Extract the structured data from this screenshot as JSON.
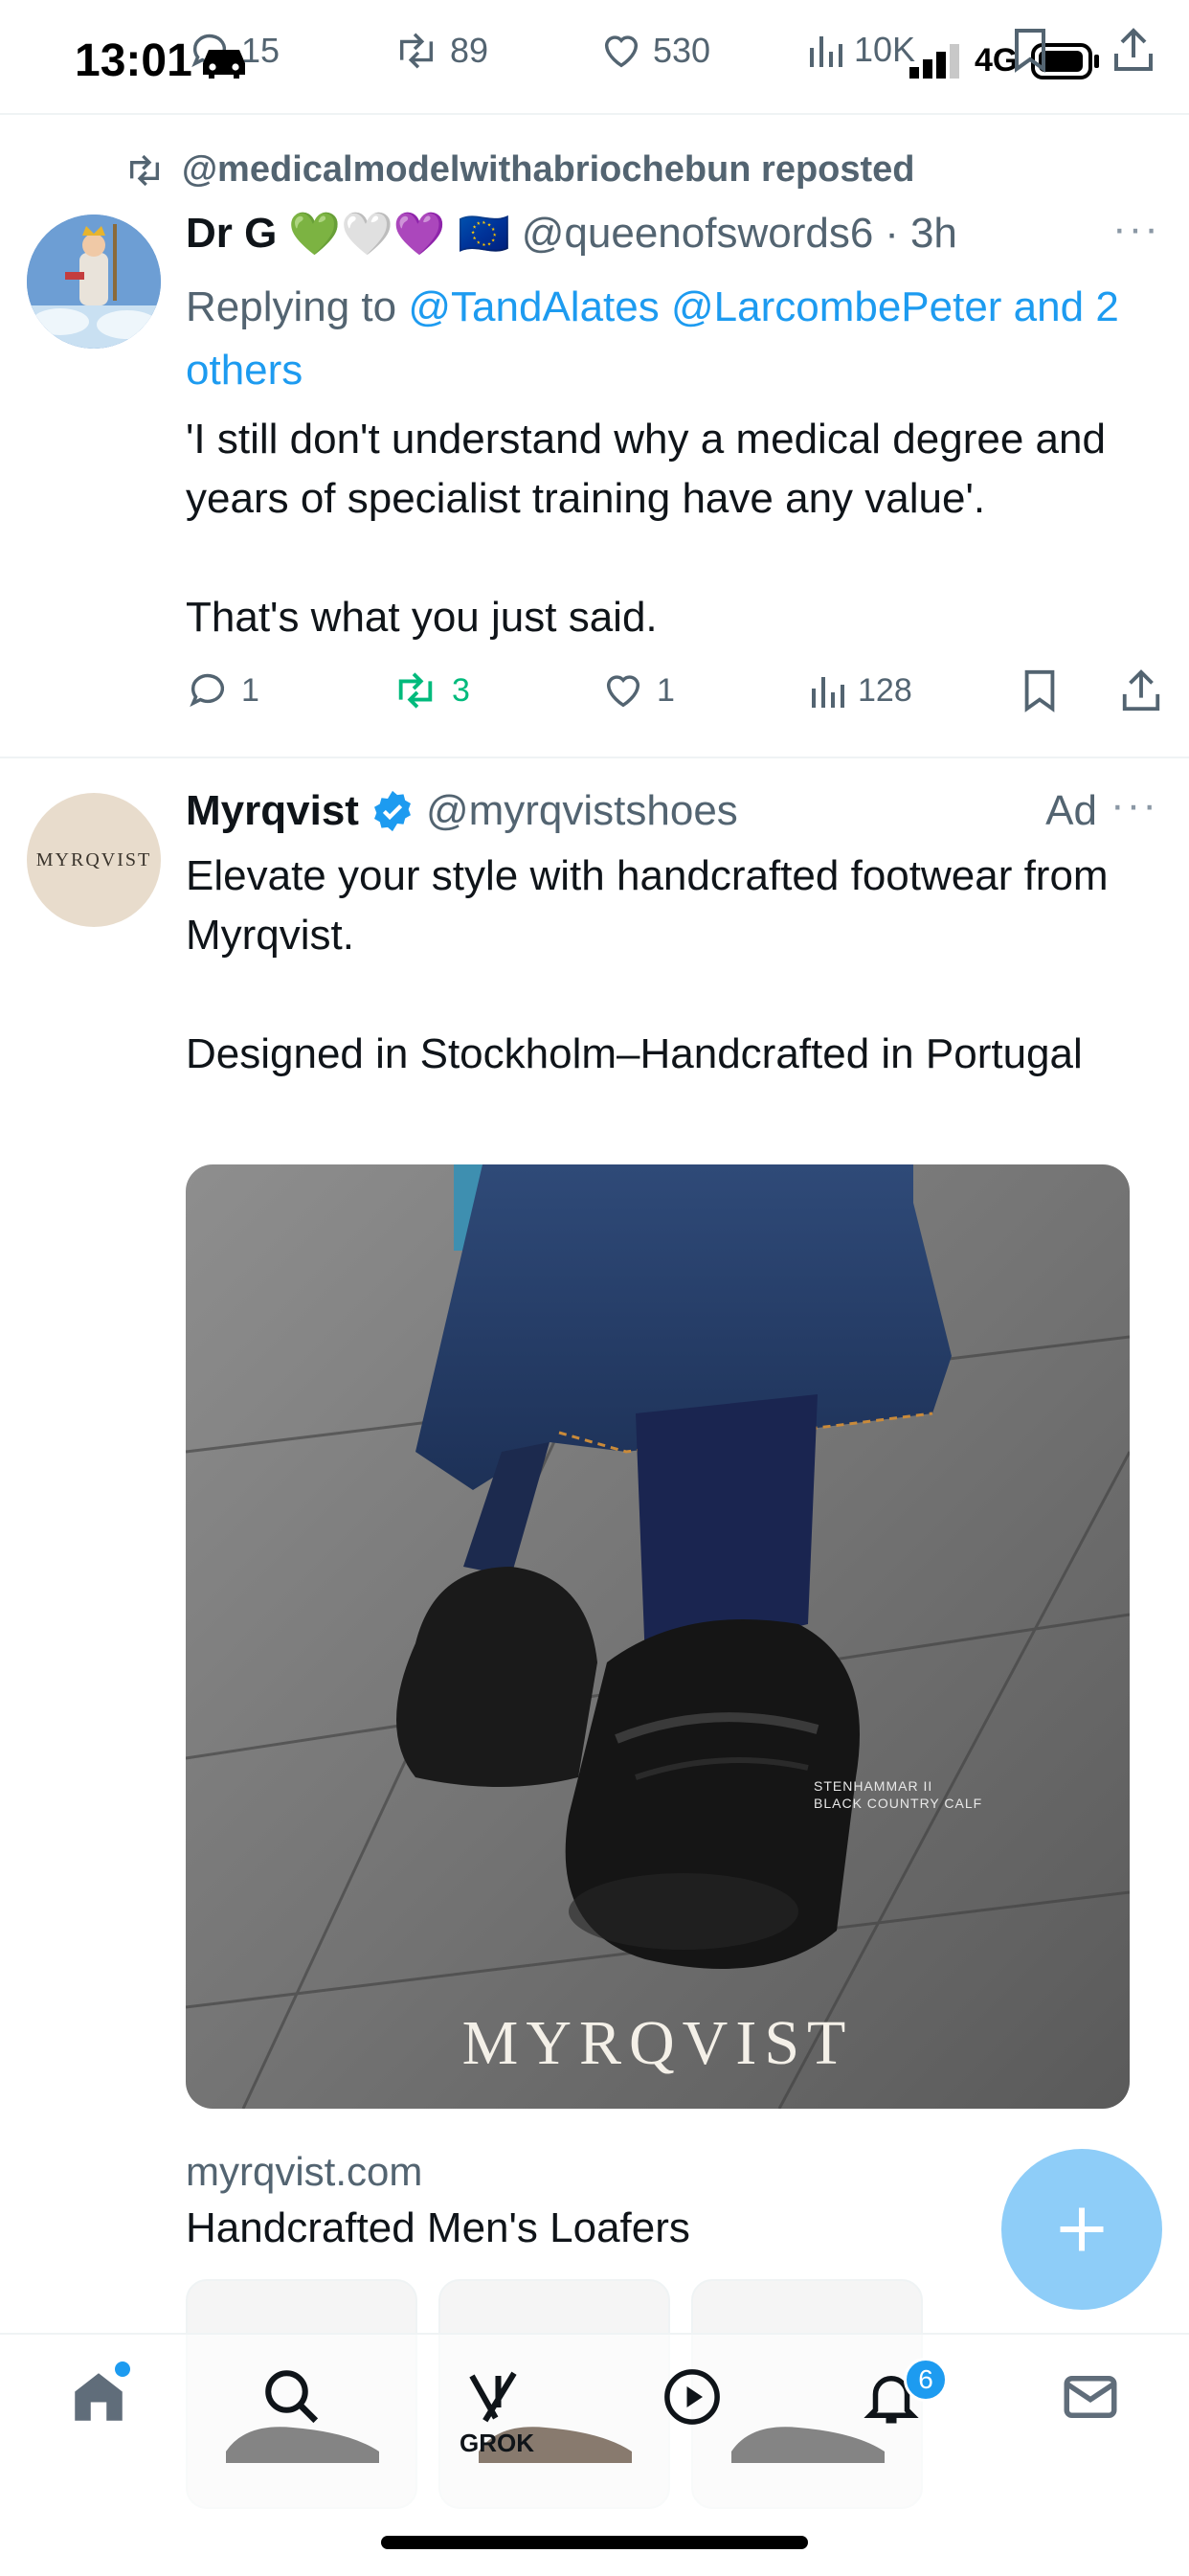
{
  "status_bar": {
    "time": "13:01",
    "network": "4G"
  },
  "top_action_bar": {
    "replies": "15",
    "reposts": "89",
    "likes": "530",
    "views": "10K"
  },
  "tweets": [
    {
      "repost_by": "@medicalmodelwithabriochebun reposted",
      "name": "Dr G",
      "emojis": "💚🤍💜 🇪🇺",
      "handle": "@queenofswords6",
      "time": "3h",
      "reply_prefix": "Replying to",
      "reply_mentions": "@TandAlates @LarcombePeter and 2 others",
      "text": "'I still don't understand why a medical degree and years of specialist training have any value'.\n\nThat's what you just said.",
      "actions": {
        "replies": "1",
        "reposts": "3",
        "likes": "1",
        "views": "128"
      }
    },
    {
      "name": "Myrqvist",
      "handle": "@myrqvistshoes",
      "ad_label": "Ad",
      "avatar_text": "MYRQVIST",
      "text": "Elevate your style with handcrafted footwear from Myrqvist.\n\nDesigned in Stockholm–Handcrafted in Portugal",
      "image_caption": "STENHAMMAR  II\nBLACK COUNTRY CALF",
      "image_brand": "MYRQVIST",
      "link_domain": "myrqvist.com",
      "link_title": "Handcrafted Men's Loafers"
    }
  ],
  "nav": {
    "grok_label": "GROK",
    "notifications_badge": "6"
  },
  "colors": {
    "accent": "#1d9bf0",
    "repost_green": "#00ba7c",
    "fab": "#8ecdf8",
    "muted": "#536471"
  }
}
